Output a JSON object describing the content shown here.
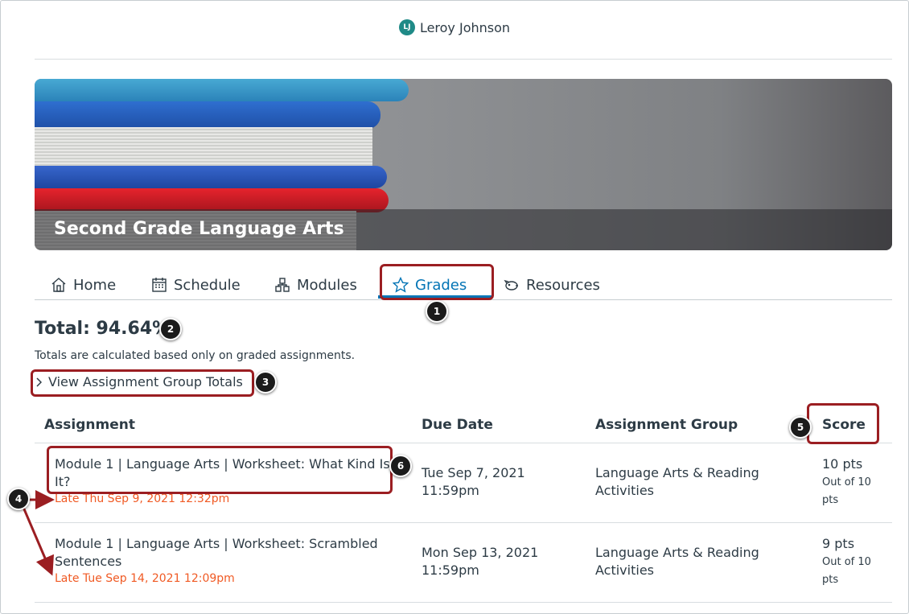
{
  "user": {
    "initials": "LJ",
    "name": "Leroy Johnson"
  },
  "course": {
    "title": "Second Grade Language Arts"
  },
  "tabs": [
    {
      "label": "Home",
      "icon": "home-icon"
    },
    {
      "label": "Schedule",
      "icon": "calendar-icon"
    },
    {
      "label": "Modules",
      "icon": "modules-icon"
    },
    {
      "label": "Grades",
      "icon": "star-icon",
      "active": true
    },
    {
      "label": "Resources",
      "icon": "piggy-bank-icon"
    }
  ],
  "grades": {
    "total": "Total: 94.64%",
    "note": "Totals are calculated based only on graded assignments.",
    "view_groups": "View Assignment Group Totals"
  },
  "table": {
    "headers": {
      "assignment": "Assignment",
      "due": "Due Date",
      "group": "Assignment Group",
      "score": "Score"
    },
    "rows": [
      {
        "title": "Module 1 | Language Arts | Worksheet: What Kind Is It?",
        "late": "Late Thu Sep 9, 2021 12:32pm",
        "due": "Tue Sep 7, 2021 11:59pm",
        "group": "Language Arts & Reading Activities",
        "score": "10 pts",
        "out_of": "Out of 10 pts"
      },
      {
        "title": "Module 1 | Language Arts | Worksheet: Scrambled Sentences",
        "late": "Late Tue Sep 14, 2021 12:09pm",
        "due": "Mon Sep 13, 2021 11:59pm",
        "group": "Language Arts & Reading Activities",
        "score": "9 pts",
        "out_of": "Out of 10 pts"
      }
    ]
  },
  "callouts": [
    "1",
    "2",
    "3",
    "4",
    "5",
    "6"
  ],
  "colors": {
    "accent": "#0374b5",
    "late": "#f05a24",
    "highlight": "#9b1e22",
    "avatar": "#1f8a87"
  }
}
